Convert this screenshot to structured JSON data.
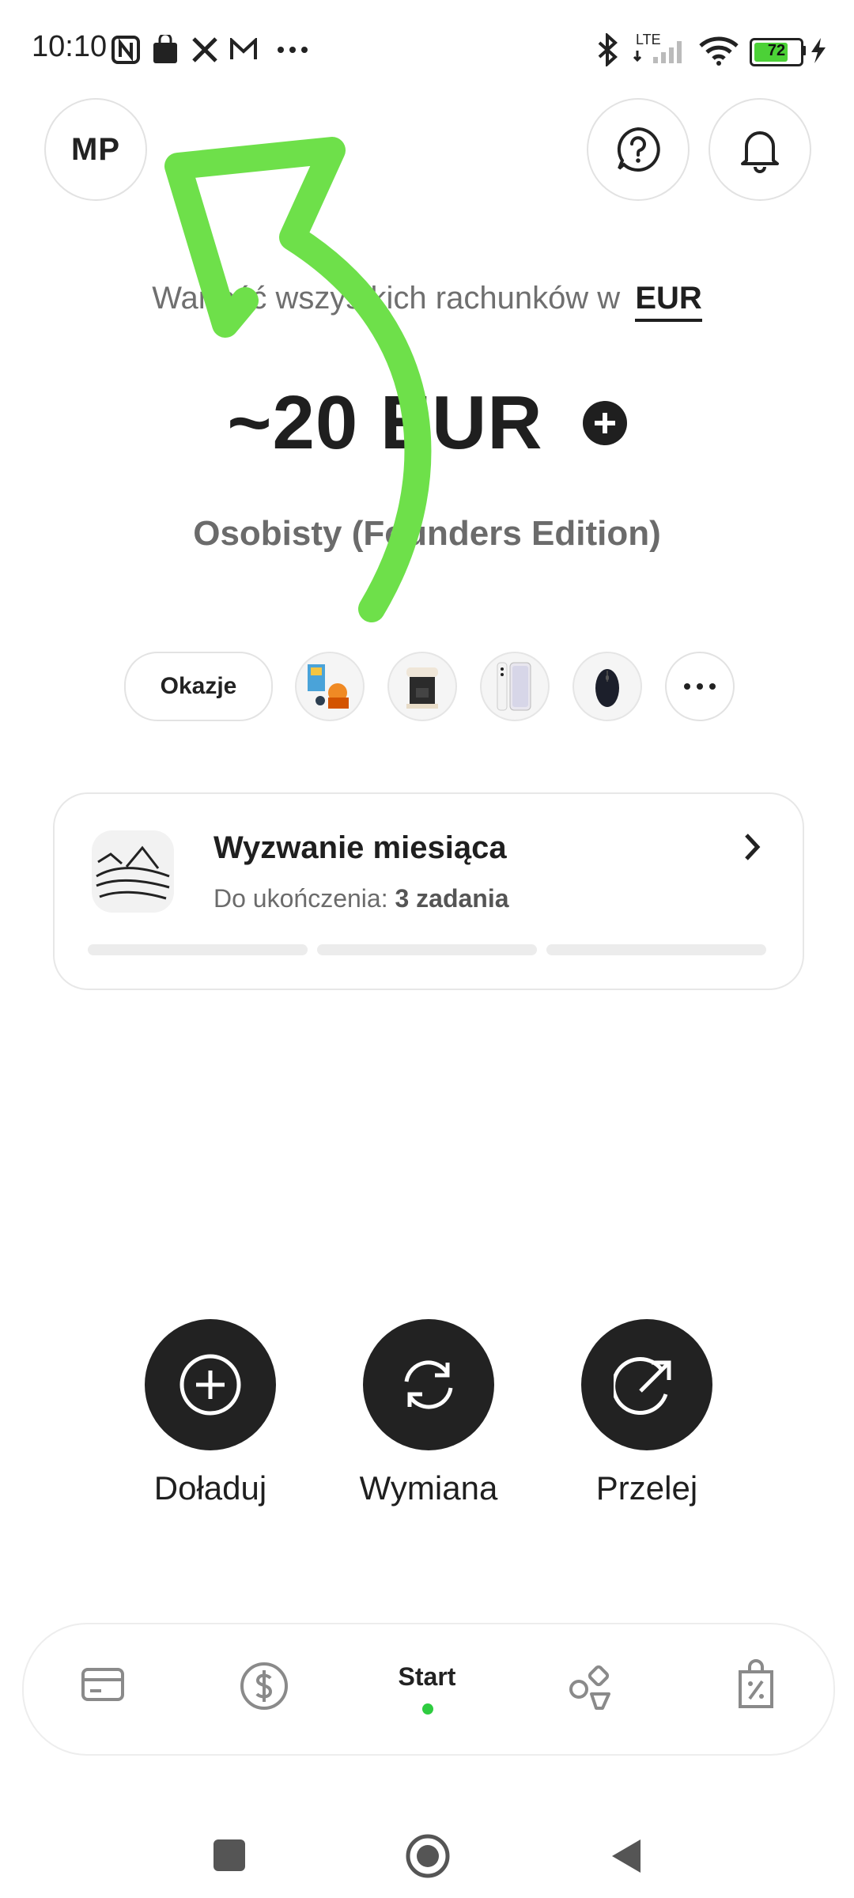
{
  "status_bar": {
    "time": "10:10",
    "network": "LTE",
    "battery": "72",
    "left_icons": [
      "nfc-icon",
      "shopping-bag-icon",
      "x-icon",
      "mail-icon",
      "more-icon"
    ],
    "right_icons": [
      "bluetooth-icon",
      "signal-icon",
      "wifi-icon",
      "battery-icon",
      "charging-icon"
    ]
  },
  "header": {
    "avatar_initials": "MP",
    "help_icon": "help-circle-icon",
    "bell_icon": "bell-icon"
  },
  "summary": {
    "label": "Wartość wszystkich rachunków w",
    "currency": "EUR",
    "balance": "~20 EUR",
    "account_name": "Osobisty (Founders Edition)"
  },
  "offers": {
    "chip_label": "Okazje",
    "products": [
      "lego-product",
      "coffee-machine-product",
      "smartphone-product",
      "mouse-product"
    ],
    "more_icon": "more-icon"
  },
  "challenge": {
    "title": "Wyzwanie miesiąca",
    "subtitle_prefix": "Do ukończenia:",
    "subtitle_value": "3 zadania",
    "progress_segments": 3,
    "completed_segments": 0
  },
  "actions": [
    {
      "label": "Doładuj",
      "icon": "plus-circle-icon"
    },
    {
      "label": "Wymiana",
      "icon": "refresh-icon"
    },
    {
      "label": "Przelej",
      "icon": "send-icon"
    }
  ],
  "bottom_nav": {
    "items": [
      "card-icon",
      "dollar-icon",
      "Start",
      "shapes-icon",
      "discount-tag-icon"
    ],
    "active": "Start"
  },
  "colors": {
    "accent": "#2ecc40",
    "dark": "#222222",
    "annotation_arrow": "#6ee04a"
  }
}
